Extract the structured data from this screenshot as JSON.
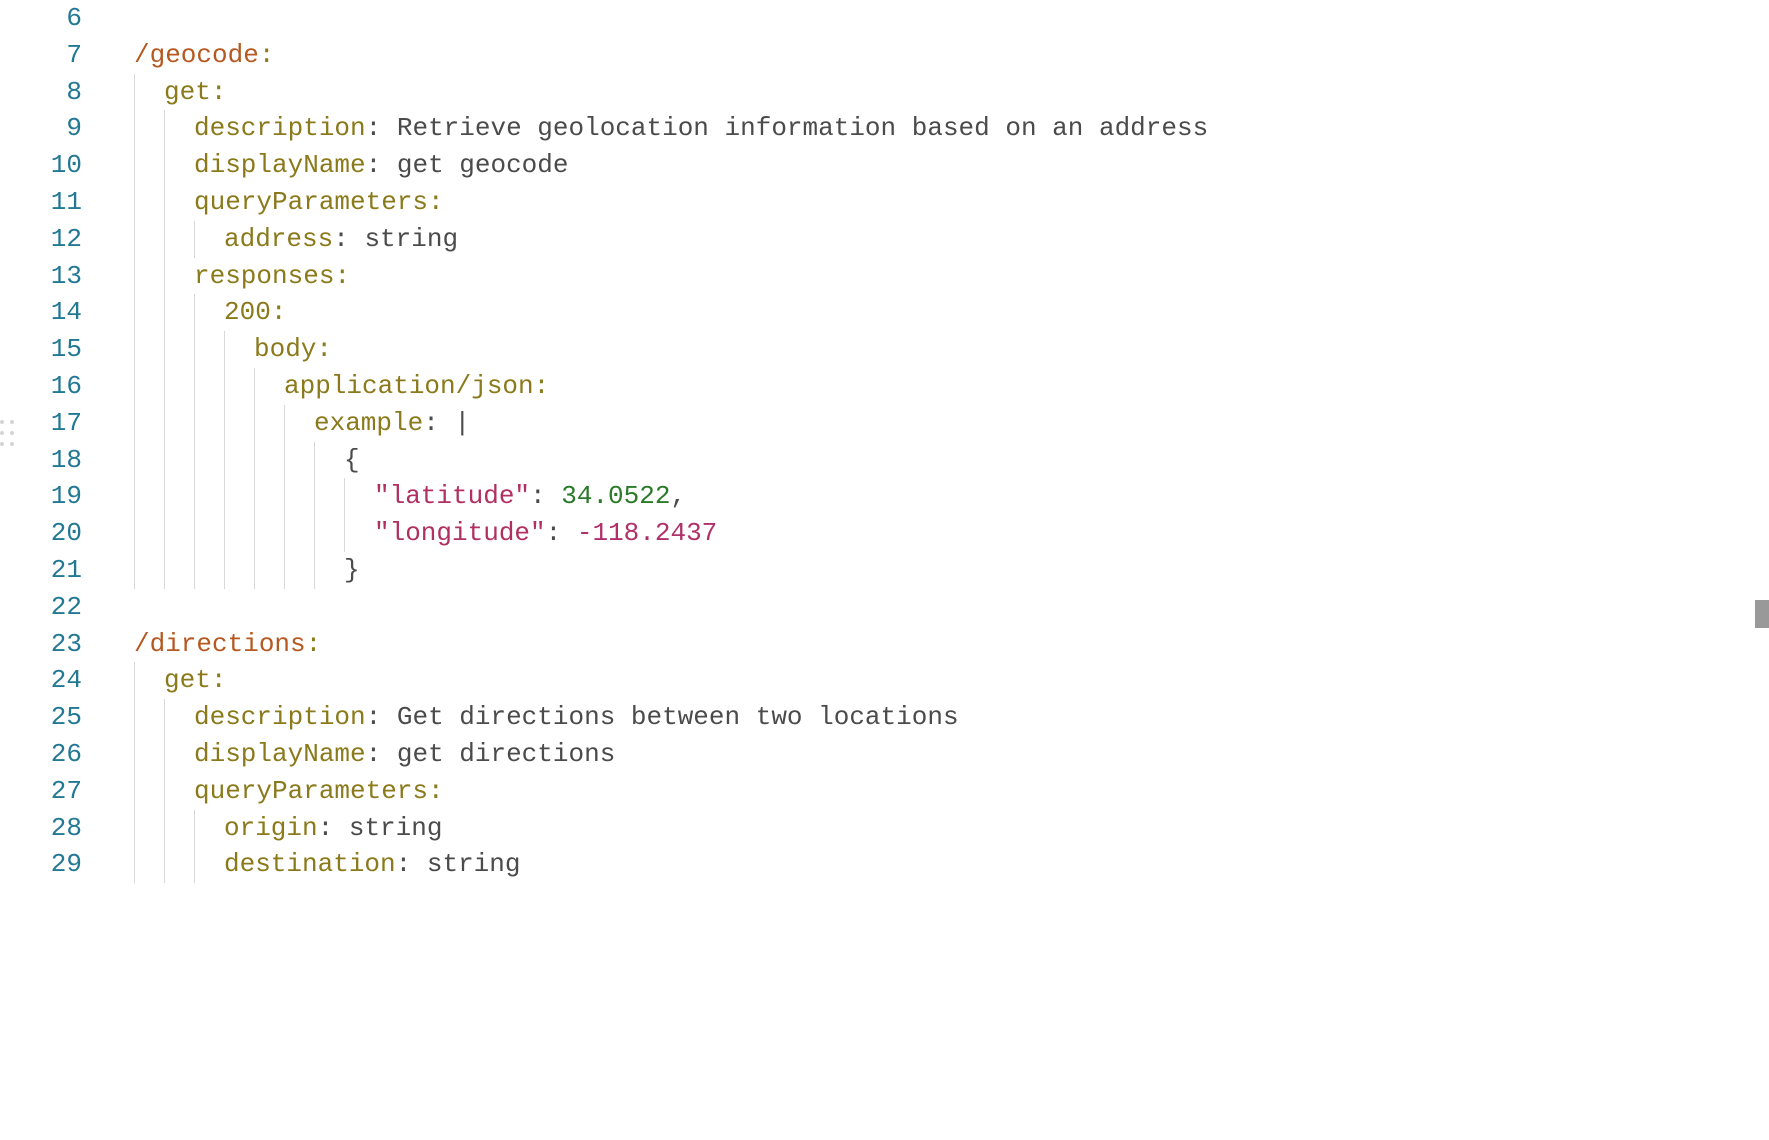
{
  "startLine": 6,
  "lines": [
    {
      "num": 6,
      "indent": 0,
      "tokens": []
    },
    {
      "num": 7,
      "indent": 0,
      "tokens": [
        {
          "t": "/geocode",
          "c": "tok-path"
        },
        {
          "t": ":",
          "c": "tok-key"
        }
      ]
    },
    {
      "num": 8,
      "indent": 1,
      "tokens": [
        {
          "t": "get",
          "c": "tok-key"
        },
        {
          "t": ":",
          "c": "tok-key"
        }
      ]
    },
    {
      "num": 9,
      "indent": 2,
      "tokens": [
        {
          "t": "description",
          "c": "tok-key"
        },
        {
          "t": ": ",
          "c": "tok-punc"
        },
        {
          "t": "Retrieve geolocation information based on an address",
          "c": "tok-str"
        }
      ]
    },
    {
      "num": 10,
      "indent": 2,
      "tokens": [
        {
          "t": "displayName",
          "c": "tok-key"
        },
        {
          "t": ": ",
          "c": "tok-punc"
        },
        {
          "t": "get geocode",
          "c": "tok-str"
        }
      ]
    },
    {
      "num": 11,
      "indent": 2,
      "tokens": [
        {
          "t": "queryParameters",
          "c": "tok-key"
        },
        {
          "t": ":",
          "c": "tok-key"
        }
      ]
    },
    {
      "num": 12,
      "indent": 3,
      "tokens": [
        {
          "t": "address",
          "c": "tok-key"
        },
        {
          "t": ": ",
          "c": "tok-punc"
        },
        {
          "t": "string",
          "c": "tok-str"
        }
      ]
    },
    {
      "num": 13,
      "indent": 2,
      "tokens": [
        {
          "t": "responses",
          "c": "tok-key"
        },
        {
          "t": ":",
          "c": "tok-key"
        }
      ]
    },
    {
      "num": 14,
      "indent": 3,
      "tokens": [
        {
          "t": "200",
          "c": "tok-key"
        },
        {
          "t": ":",
          "c": "tok-key"
        }
      ]
    },
    {
      "num": 15,
      "indent": 4,
      "tokens": [
        {
          "t": "body",
          "c": "tok-key"
        },
        {
          "t": ":",
          "c": "tok-key"
        }
      ]
    },
    {
      "num": 16,
      "indent": 5,
      "tokens": [
        {
          "t": "application/json",
          "c": "tok-key"
        },
        {
          "t": ":",
          "c": "tok-key"
        }
      ]
    },
    {
      "num": 17,
      "indent": 6,
      "tokens": [
        {
          "t": "example",
          "c": "tok-key"
        },
        {
          "t": ": ",
          "c": "tok-punc"
        },
        {
          "t": "|",
          "c": "tok-str"
        }
      ]
    },
    {
      "num": 18,
      "indent": 7,
      "tokens": [
        {
          "t": "{",
          "c": "tok-str"
        }
      ]
    },
    {
      "num": 19,
      "indent": 8,
      "tokens": [
        {
          "t": "\"latitude\"",
          "c": "tok-strq"
        },
        {
          "t": ": ",
          "c": "tok-punc"
        },
        {
          "t": "34.0522",
          "c": "tok-num"
        },
        {
          "t": ",",
          "c": "tok-punc"
        }
      ]
    },
    {
      "num": 20,
      "indent": 8,
      "tokens": [
        {
          "t": "\"longitude\"",
          "c": "tok-strq"
        },
        {
          "t": ": ",
          "c": "tok-punc"
        },
        {
          "t": "-118.2437",
          "c": "tok-numneg"
        }
      ]
    },
    {
      "num": 21,
      "indent": 7,
      "tokens": [
        {
          "t": "}",
          "c": "tok-str"
        }
      ]
    },
    {
      "num": 22,
      "indent": 0,
      "tokens": []
    },
    {
      "num": 23,
      "indent": 0,
      "tokens": [
        {
          "t": "/directions",
          "c": "tok-path"
        },
        {
          "t": ":",
          "c": "tok-key"
        }
      ]
    },
    {
      "num": 24,
      "indent": 1,
      "tokens": [
        {
          "t": "get",
          "c": "tok-key"
        },
        {
          "t": ":",
          "c": "tok-key"
        }
      ]
    },
    {
      "num": 25,
      "indent": 2,
      "tokens": [
        {
          "t": "description",
          "c": "tok-key"
        },
        {
          "t": ": ",
          "c": "tok-punc"
        },
        {
          "t": "Get directions between two locations",
          "c": "tok-str"
        }
      ]
    },
    {
      "num": 26,
      "indent": 2,
      "tokens": [
        {
          "t": "displayName",
          "c": "tok-key"
        },
        {
          "t": ": ",
          "c": "tok-punc"
        },
        {
          "t": "get directions",
          "c": "tok-str"
        }
      ]
    },
    {
      "num": 27,
      "indent": 2,
      "tokens": [
        {
          "t": "queryParameters",
          "c": "tok-key"
        },
        {
          "t": ":",
          "c": "tok-key"
        }
      ]
    },
    {
      "num": 28,
      "indent": 3,
      "tokens": [
        {
          "t": "origin",
          "c": "tok-key"
        },
        {
          "t": ": ",
          "c": "tok-punc"
        },
        {
          "t": "string",
          "c": "tok-str"
        }
      ]
    },
    {
      "num": 29,
      "indent": 3,
      "tokens": [
        {
          "t": "destination",
          "c": "tok-key"
        },
        {
          "t": ": ",
          "c": "tok-punc"
        },
        {
          "t": "string",
          "c": "tok-str"
        }
      ]
    }
  ],
  "indentWidthPx": 30,
  "baseOffsetPx": 34
}
